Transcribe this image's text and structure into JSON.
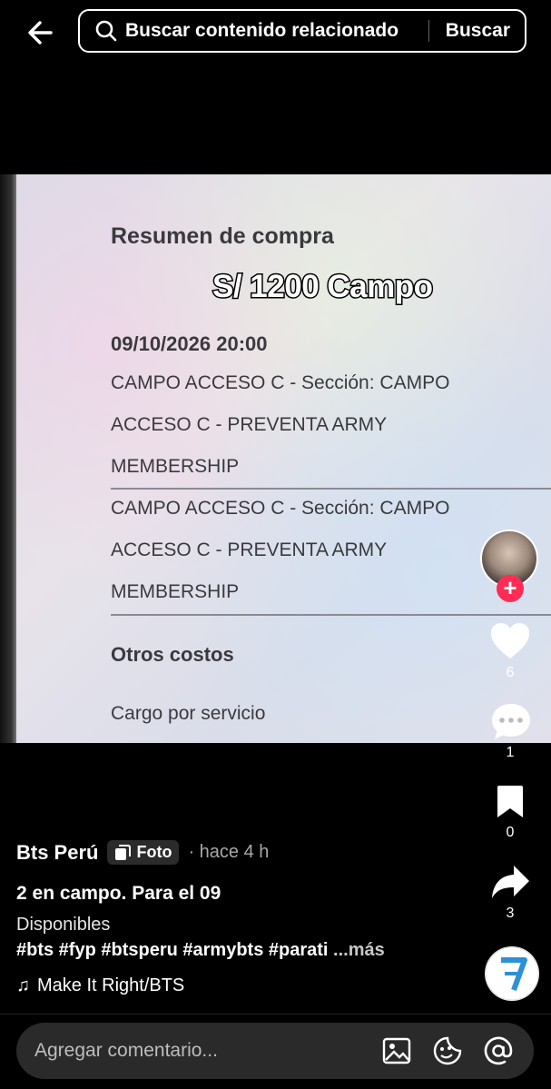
{
  "header": {
    "search_placeholder": "Buscar contenido relacionado",
    "search_button": "Buscar"
  },
  "photo": {
    "doc_title": "Resumen de compra",
    "overlay_text": "S/ 1200 Campo",
    "date": "09/10/2026 20:00",
    "lines_a": [
      "CAMPO ACCESO C - Sección: CAMPO",
      "ACCESO C - PREVENTA ARMY",
      "MEMBERSHIP"
    ],
    "lines_b": [
      "CAMPO ACCESO C - Sección: CAMPO",
      "ACCESO C - PREVENTA ARMY",
      "MEMBERSHIP"
    ],
    "other_costs": "Otros costos",
    "service_fee": "Cargo por servicio"
  },
  "actions": {
    "likes": "6",
    "comments": "1",
    "saves": "0",
    "shares": "3"
  },
  "caption": {
    "author": "Bts Perú",
    "badge": "Foto",
    "time": "· hace 4 h",
    "title": "2 en campo. Para el 09",
    "description": "Disponibles",
    "hashtags": "#bts #fyp #btsperu #armybts #parati",
    "more": "...más",
    "music": "Make It Right/BTS"
  },
  "comment_bar": {
    "placeholder": "Agregar comentario..."
  },
  "colors": {
    "follow_badge": "#fe2c55",
    "background": "#000000"
  }
}
